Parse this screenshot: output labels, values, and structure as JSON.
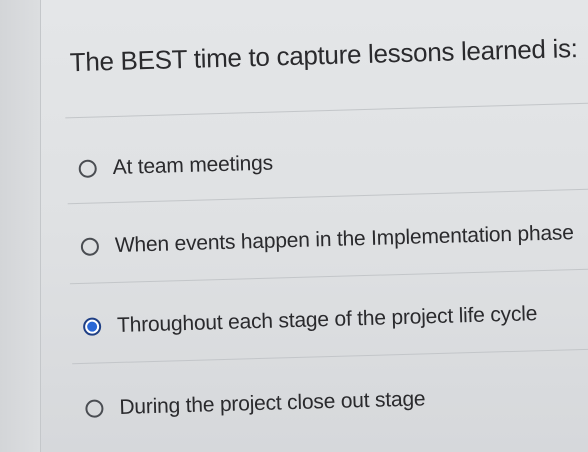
{
  "question": {
    "text": "The BEST time to capture lessons learned is:"
  },
  "options": [
    {
      "label": "At team meetings",
      "selected": false
    },
    {
      "label": "When events happen in the Implementation phase",
      "selected": false
    },
    {
      "label": "Throughout each stage of the project life cycle",
      "selected": true
    },
    {
      "label": "During the project close out stage",
      "selected": false
    }
  ],
  "colors": {
    "selected_radio": "#2a67d6",
    "text": "#2a2a2d",
    "background": "#e0e2e4"
  }
}
